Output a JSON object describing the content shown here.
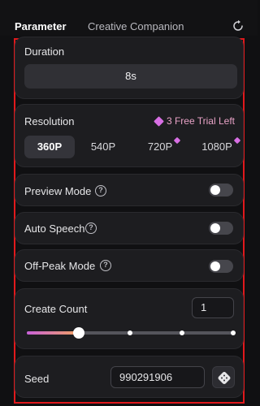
{
  "header": {
    "tabs": [
      {
        "label": "Parameter",
        "active": true
      },
      {
        "label": "Creative Companion",
        "active": false
      }
    ],
    "reset_icon": "refresh-icon"
  },
  "duration": {
    "label": "Duration",
    "value": "8s"
  },
  "resolution": {
    "label": "Resolution",
    "trial_text": "3 Free Trial Left",
    "options": [
      {
        "label": "360P",
        "selected": true,
        "premium": false
      },
      {
        "label": "540P",
        "selected": false,
        "premium": false
      },
      {
        "label": "720P",
        "selected": false,
        "premium": true
      },
      {
        "label": "1080P",
        "selected": false,
        "premium": true
      }
    ]
  },
  "preview_mode": {
    "label": "Preview Mode",
    "enabled": false
  },
  "auto_speech": {
    "label": "Auto Speech",
    "enabled": false
  },
  "off_peak_mode": {
    "label": "Off-Peak Mode",
    "enabled": false
  },
  "create_count": {
    "label": "Create Count",
    "value": "1",
    "slider_value": 1,
    "slider_steps": [
      1,
      2,
      3,
      4
    ]
  },
  "seed": {
    "label": "Seed",
    "value": "990291906"
  },
  "colors": {
    "accent_gem": "#d86fe4",
    "trial_text": "#e8a2c6",
    "highlight_border": "#e1191c",
    "toggle_off": "#46464c"
  }
}
